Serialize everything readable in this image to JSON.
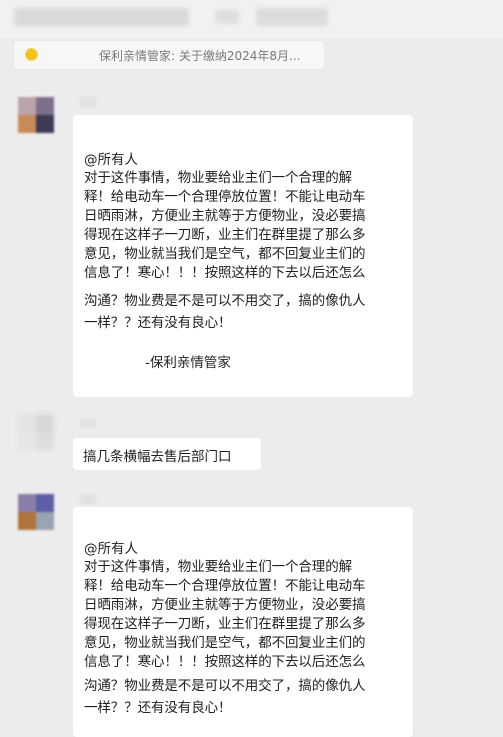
{
  "pinned": {
    "text": "保利亲情管家: 关于缴纳2024年8月..."
  },
  "messages": [
    {
      "mention": "@所有人",
      "lines": [
        "对于这件事情，物业要给业主们一个合理的解",
        "释！给电动车一个合理停放位置！不能让电动车",
        "日晒雨淋，方便业主就等于方便物业，没必要搞",
        "得现在这样子一刀断，业主们在群里提了那么多",
        "意见，物业就当我们是空气，都不回复业主们的",
        "信息了！寒心！！！按照这样的下去以后还怎么",
        "沟通？物业费是不是可以不用交了，搞的像仇人",
        "一样？？还有没有良心！"
      ],
      "signature": "-保利亲情管家"
    },
    {
      "text": "搞几条横幅去售后部门口"
    },
    {
      "mention": "@所有人",
      "lines": [
        "对于这件事情，物业要给业主们一个合理的解",
        "释！给电动车一个合理停放位置！不能让电动车",
        "日晒雨淋，方便业主就等于方便物业，没必要搞",
        "得现在这样子一刀断，业主们在群里提了那么多",
        "意见，物业就当我们是空气，都不回复业主们的",
        "信息了！寒心！！！按照这样的下去以后还怎么",
        "沟通？物业费是不是可以不用交了，搞的像仇人",
        "一样？？还有没有良心！"
      ]
    }
  ]
}
